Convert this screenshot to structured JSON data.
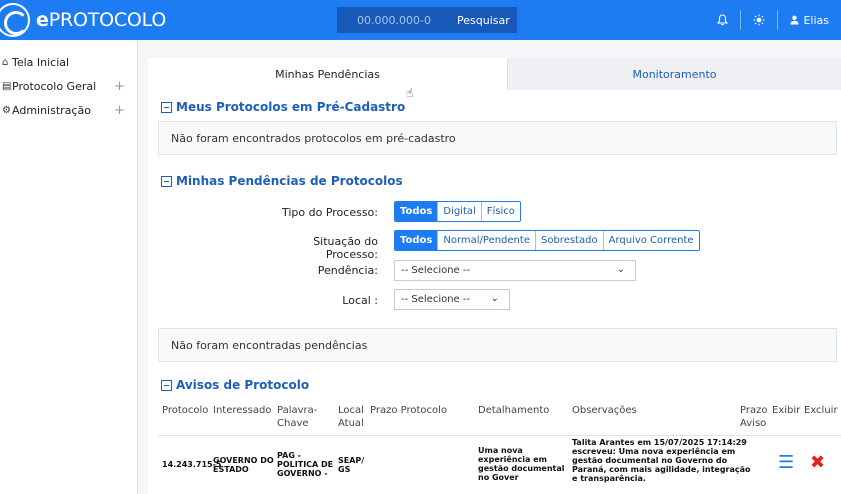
{
  "topbar": {
    "logo_text_bold": "e",
    "logo_text": "PROTOCOLO",
    "search_value": "00.000.000-0",
    "search_button": "Pesquisar",
    "bell_icon": "bell-icon",
    "theme_icon": "sun-icon",
    "user_name": "Elias"
  },
  "sidebar": {
    "items": [
      {
        "label": "Tela Inicial",
        "icon": "home-icon"
      },
      {
        "label": "Protocolo Geral",
        "icon": "document-icon"
      },
      {
        "label": "Administração",
        "icon": "settings-icon"
      }
    ]
  },
  "tabs": {
    "active": "Minhas Pendências",
    "inactive": "Monitoramento"
  },
  "precadastro": {
    "title": "Meus Protocolos em Pré-Cadastro",
    "empty": "Não foram encontrados protocolos em pré-cadastro"
  },
  "pendencias": {
    "title": "Minhas Pendências de Protocolos",
    "tipo_label": "Tipo do Processo:",
    "tipo_options": [
      "Todos",
      "Digital",
      "Físico"
    ],
    "situacao_label": "Situação do Processo:",
    "situacao_options": [
      "Todos",
      "Normal/Pendente",
      "Sobrestado",
      "Arquivo Corrente"
    ],
    "pendencia_label": "Pendência:",
    "pendencia_value": "-- Selecione --",
    "local_label": "Local :",
    "local_value": "-- Selecione --",
    "empty": "Não foram encontradas pendências"
  },
  "avisos": {
    "title": "Avisos de Protocolo",
    "columns": {
      "protocolo": "Protocolo",
      "interessado": "Interessado",
      "palavra_chave_1": "Palavra-",
      "palavra_chave_2": "Chave",
      "local_1": "Local",
      "local_2": "Atual",
      "prazo_protocolo": "Prazo Protocolo",
      "detalhamento": "Detalhamento",
      "observacoes": "Observações",
      "prazo_aviso_1": "Prazo",
      "prazo_aviso_2": "Aviso",
      "exibir": "Exibir",
      "excluir": "Excluir"
    },
    "rows": [
      {
        "protocolo": "14.243.715-5",
        "interessado_1": "GOVERNO DO",
        "interessado_2": "ESTADO",
        "palavra_1": "PAG -",
        "palavra_2": "POLITICA DE",
        "palavra_3": "GOVERNO -",
        "local_1": "SEAP/",
        "local_2": "GS",
        "detalhe_1": "Uma nova",
        "detalhe_2": "experiência em",
        "detalhe_3": "gestão documental",
        "detalhe_4": "no Gover",
        "obs_1": "Talita Arantes em 15/07/2025 17:14:29",
        "obs_2": "escreveu: Uma nova experiência em",
        "obs_3": "gestão documental no Governo do",
        "obs_4": "Paraná, com mais agilidade, integração",
        "obs_5": "e transparência."
      }
    ]
  }
}
